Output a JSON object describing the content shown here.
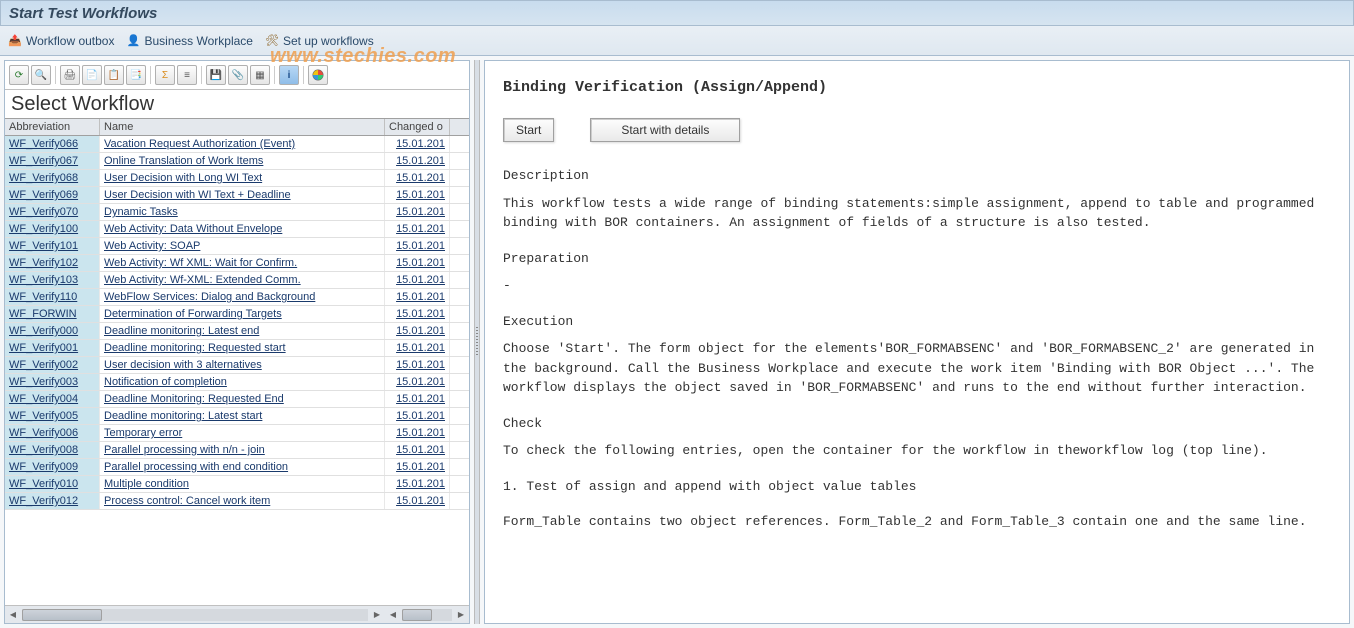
{
  "title": "Start Test Workflows",
  "actions": {
    "workflow_outbox": "Workflow outbox",
    "business_workplace": "Business Workplace",
    "set_up_workflows": "Set up workflows"
  },
  "watermark": "www.stechies.com",
  "left": {
    "panel_title": "Select Workflow",
    "columns": {
      "abbr": "Abbreviation",
      "name": "Name",
      "changed": "Changed o"
    },
    "rows": [
      {
        "abbr": "WF_Verify066",
        "name": "Vacation Request Authorization (Event)",
        "date": "15.01.201"
      },
      {
        "abbr": "WF_Verify067",
        "name": "Online Translation of Work Items",
        "date": "15.01.201"
      },
      {
        "abbr": "WF_Verify068",
        "name": "User Decision with Long WI Text",
        "date": "15.01.201"
      },
      {
        "abbr": "WF_Verify069",
        "name": "User Decision with WI Text + Deadline",
        "date": "15.01.201"
      },
      {
        "abbr": "WF_Verify070",
        "name": "Dynamic Tasks",
        "date": "15.01.201"
      },
      {
        "abbr": "WF_Verify100",
        "name": "Web Activity: Data Without Envelope",
        "date": "15.01.201"
      },
      {
        "abbr": "WF_Verify101",
        "name": "Web Activity: SOAP",
        "date": "15.01.201"
      },
      {
        "abbr": "WF_Verify102",
        "name": "Web Activity: Wf XML: Wait for Confirm.",
        "date": "15.01.201"
      },
      {
        "abbr": "WF_Verify103",
        "name": "Web Activity: Wf-XML: Extended Comm.",
        "date": "15.01.201"
      },
      {
        "abbr": "WF_Verify110",
        "name": "WebFlow Services: Dialog and Background",
        "date": "15.01.201"
      },
      {
        "abbr": "WF_FORWIN",
        "name": "Determination of Forwarding Targets",
        "date": "15.01.201"
      },
      {
        "abbr": "WF_Verify000",
        "name": "Deadline monitoring: Latest end",
        "date": "15.01.201"
      },
      {
        "abbr": "WF_Verify001",
        "name": "Deadline monitoring: Requested start",
        "date": "15.01.201"
      },
      {
        "abbr": "WF_Verify002",
        "name": "User decision with 3 alternatives",
        "date": "15.01.201"
      },
      {
        "abbr": "WF_Verify003",
        "name": "Notification of completion",
        "date": "15.01.201"
      },
      {
        "abbr": "WF_Verify004",
        "name": "Deadline Monitoring: Requested End",
        "date": "15.01.201"
      },
      {
        "abbr": "WF_Verify005",
        "name": "Deadline monitoring: Latest start",
        "date": "15.01.201"
      },
      {
        "abbr": "WF_Verify006",
        "name": "Temporary error",
        "date": "15.01.201"
      },
      {
        "abbr": "WF_Verify008",
        "name": "Parallel processing with n/n - join",
        "date": "15.01.201"
      },
      {
        "abbr": "WF_Verify009",
        "name": "Parallel processing with end condition",
        "date": "15.01.201"
      },
      {
        "abbr": "WF_Verify010",
        "name": "Multiple condition",
        "date": "15.01.201"
      },
      {
        "abbr": "WF_Verify012",
        "name": "Process control: Cancel work item",
        "date": "15.01.201"
      }
    ]
  },
  "detail": {
    "heading": "Binding Verification (Assign/Append)",
    "start_label": "Start",
    "start_details_label": "Start with details",
    "sections": {
      "desc_label": "Description",
      "desc_text": "This workflow tests a wide range of binding statements:simple assignment, append to table and programmed binding with BOR containers. An assignment of fields of a structure is also tested.",
      "prep_label": "Preparation",
      "prep_text": "-",
      "exec_label": "Execution",
      "exec_text": "Choose 'Start'. The form object for the elements'BOR_FORMABSENC' and 'BOR_FORMABSENC_2' are generated in the background. Call the Business Workplace and execute the work item 'Binding with BOR Object ...'. The workflow displays the object saved in 'BOR_FORMABSENC' and runs to the end without further interaction.",
      "check_label": "Check",
      "check_text1": "To check the following entries, open the container for the workflow in theworkflow log (top line).",
      "check_text2": "1. Test of assign and append with object value tables",
      "check_text3": "Form_Table contains two object references. Form_Table_2 and Form_Table_3 contain one and the same line."
    }
  }
}
